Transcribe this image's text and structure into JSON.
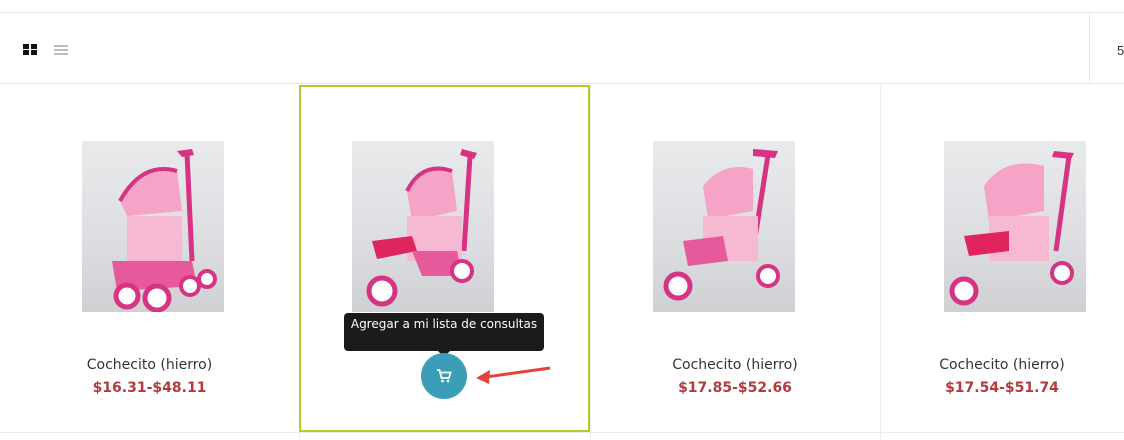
{
  "toolbar": {
    "view_modes": [
      {
        "name": "grid",
        "icon": "grid-icon",
        "active": true
      },
      {
        "name": "list",
        "icon": "list-icon",
        "active": false
      }
    ],
    "right_text": "5"
  },
  "products": [
    {
      "title": "Cochecito (hierro)",
      "price": "$16.31-$48.11",
      "stroller": "four-wheel"
    },
    {
      "title": "",
      "price": "",
      "stroller": "three-wheel",
      "highlighted": true,
      "tooltip": "Agregar a mi lista de consultas",
      "action_icon": "cart-icon"
    },
    {
      "title": "Cochecito (hierro)",
      "price": "$17.85-$52.66",
      "stroller": "three-wheel"
    },
    {
      "title": "Cochecito (hierro)",
      "price": "$17.54-$51.74",
      "stroller": "three-wheel"
    }
  ],
  "colors": {
    "highlight_border": "#b5c92a",
    "price": "#b23a3a",
    "cart_button": "#3b9db8",
    "tooltip_bg": "#1b1b1b",
    "annotation_arrow": "#e8413b"
  }
}
